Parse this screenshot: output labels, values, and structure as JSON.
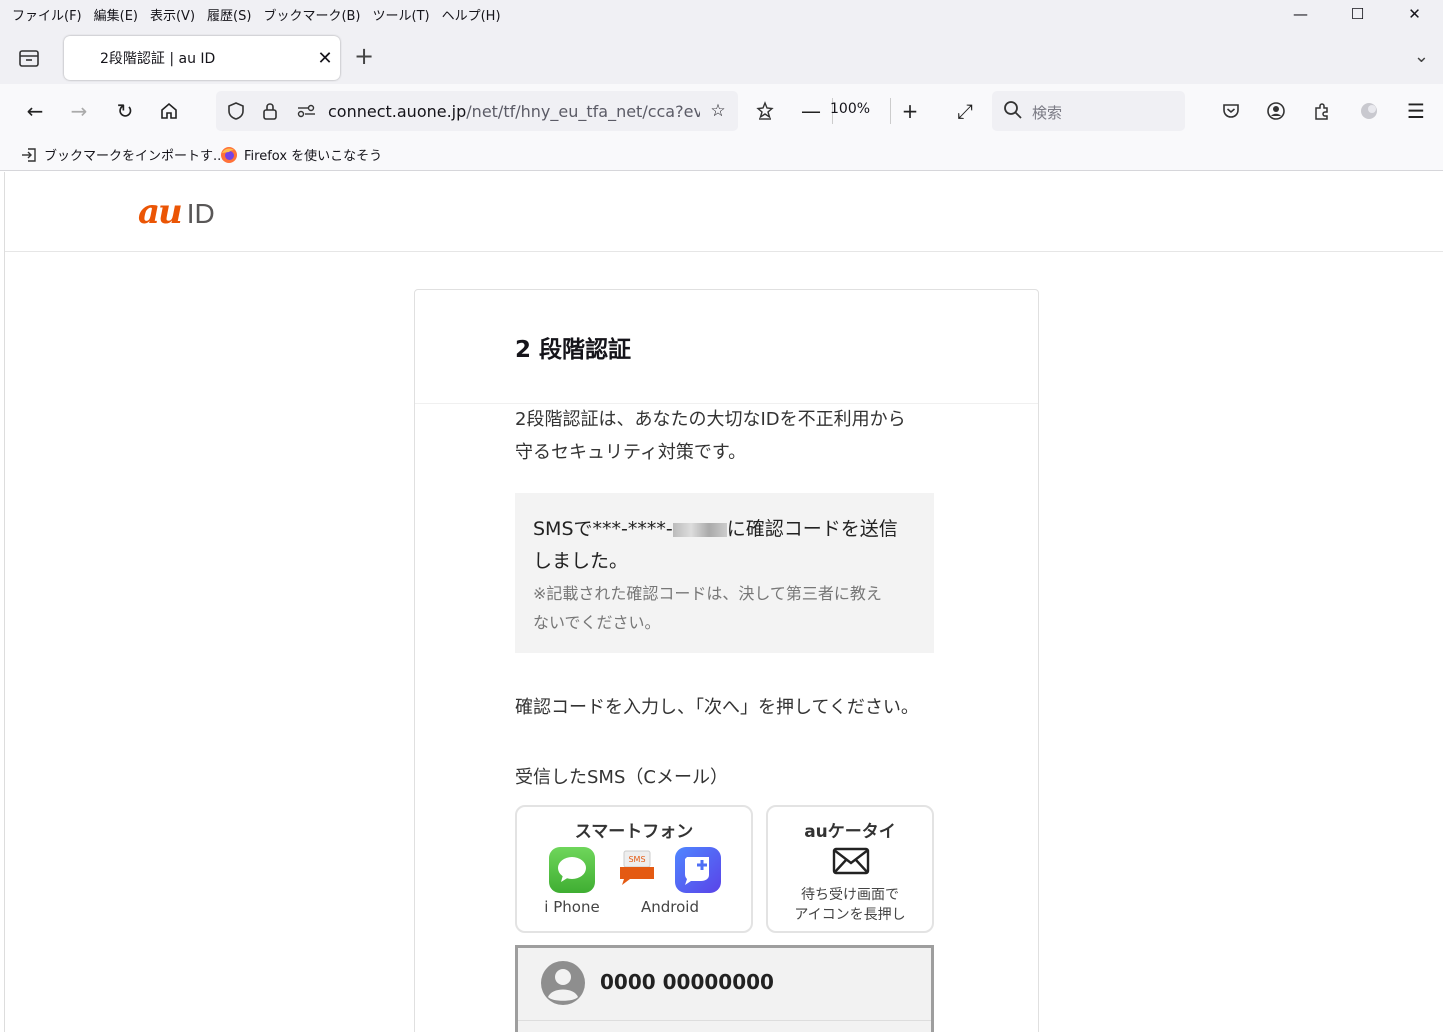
{
  "menu": [
    "ファイル(F)",
    "編集(E)",
    "表示(V)",
    "履歴(S)",
    "ブックマーク(B)",
    "ツール(T)",
    "ヘルプ(H)"
  ],
  "tab": {
    "title": "2段階認証 | au ID"
  },
  "url": {
    "host": "connect.auone.jp",
    "path": "/net/tf/hny_eu_tfa_net/cca?even"
  },
  "zoom": "100%",
  "search": {
    "placeholder": "検索"
  },
  "bookmarks": [
    "ブックマークをインポートす...",
    "Firefox を使いこなそう"
  ],
  "site": {
    "logo_au": "au",
    "logo_id": "ID"
  },
  "card": {
    "title": "2 段階認証",
    "intro_line1": "2段階認証は、あなたの大切なIDを不正利用から",
    "intro_line2": "守るセキュリティ対策です。",
    "sms_prefix": "SMSで***-****-",
    "sms_suffix": "に確認コードを送信",
    "sms_line2": "しました。",
    "warning_line1": "※記載された確認コードは、決して第三者に教え",
    "warning_line2": "ないでください。",
    "instruction": "確認コードを入力し、「次へ」を押してください。",
    "sms_label": "受信したSMS（Cメール）",
    "smartphone": {
      "title": "スマートフォン",
      "iphone": "i Phone",
      "android": "Android",
      "sms_tag": "SMS"
    },
    "aukeitai": {
      "title": "auケータイ",
      "desc_line1": "待ち受け画面で",
      "desc_line2": "アイコンを長押し"
    },
    "contact_number": "0000 00000000"
  },
  "colors": {
    "au_orange": "#eb5505",
    "logo_gray": "#595757",
    "imessage_green": "#5ac146",
    "android_msg_blue": "#3b6ff5"
  }
}
